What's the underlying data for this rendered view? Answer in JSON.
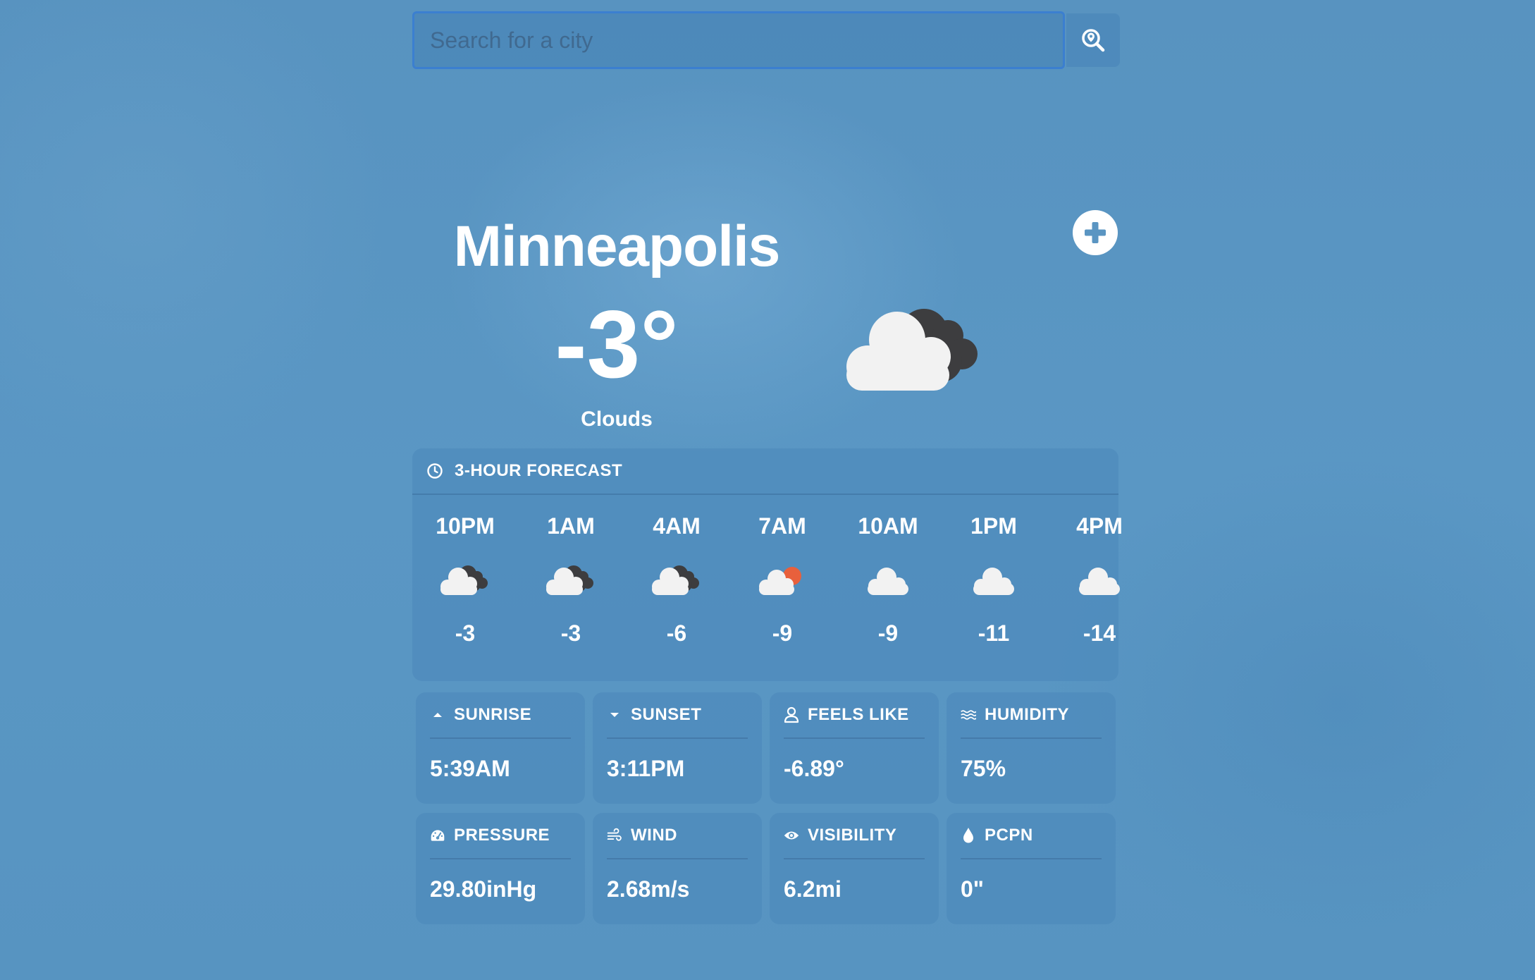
{
  "search": {
    "placeholder": "Search for a city",
    "value": "",
    "button_icon": "search-location-icon"
  },
  "location": {
    "city": "Minneapolis",
    "temperature": "-3°",
    "condition": "Clouds",
    "icon": "clouds-night-icon"
  },
  "add_button": {
    "icon": "plus-circle-icon"
  },
  "forecast": {
    "title": "3-HOUR FORECAST",
    "icon": "clock-icon",
    "hours": [
      {
        "time": "10PM",
        "temp": "-3",
        "icon": "clouds-night-icon"
      },
      {
        "time": "1AM",
        "temp": "-3",
        "icon": "clouds-night-icon"
      },
      {
        "time": "4AM",
        "temp": "-6",
        "icon": "clouds-night-icon"
      },
      {
        "time": "7AM",
        "temp": "-9",
        "icon": "clouds-day-icon"
      },
      {
        "time": "10AM",
        "temp": "-9",
        "icon": "cloud-icon"
      },
      {
        "time": "1PM",
        "temp": "-11",
        "icon": "cloud-icon"
      },
      {
        "time": "4PM",
        "temp": "-14",
        "icon": "cloud-icon"
      }
    ]
  },
  "details": [
    {
      "label": "SUNRISE",
      "value": "5:39AM",
      "icon": "caret-up-icon"
    },
    {
      "label": "SUNSET",
      "value": "3:11PM",
      "icon": "caret-down-icon"
    },
    {
      "label": "FEELS LIKE",
      "value": "-6.89°",
      "icon": "person-icon"
    },
    {
      "label": "HUMIDITY",
      "value": "75%",
      "icon": "water-icon"
    },
    {
      "label": "PRESSURE",
      "value": "29.80inHg",
      "icon": "gauge-icon"
    },
    {
      "label": "WIND",
      "value": "2.68m/s",
      "icon": "wind-icon"
    },
    {
      "label": "VISIBILITY",
      "value": "6.2mi",
      "icon": "eye-icon"
    },
    {
      "label": "PCPN",
      "value": "0\"",
      "icon": "droplet-icon"
    }
  ],
  "colors": {
    "cloud": "#f2f2f2",
    "dark_cloud": "#3d3d3f",
    "sun": "#e8603c",
    "accent_border": "#3b7fd0"
  }
}
